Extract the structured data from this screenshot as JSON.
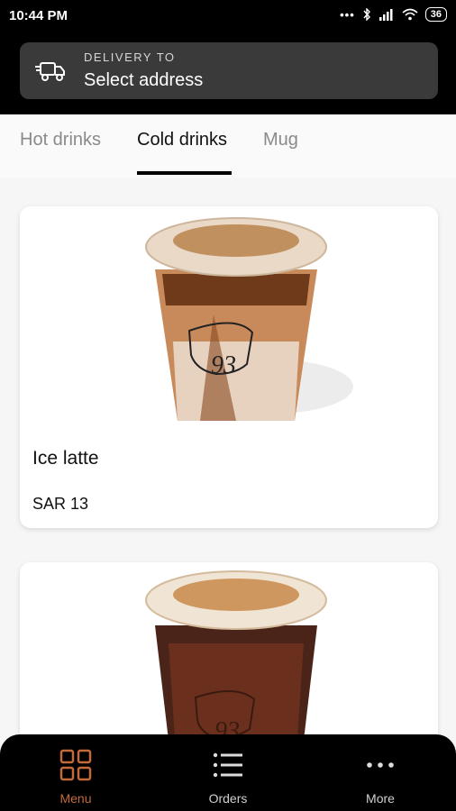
{
  "status_bar": {
    "time": "10:44 PM",
    "signal_dots": "•••",
    "battery": "36"
  },
  "delivery": {
    "label": "DELIVERY TO",
    "value": "Select address"
  },
  "tabs": [
    {
      "label": "Hot drinks",
      "active": false
    },
    {
      "label": "Cold drinks",
      "active": true
    },
    {
      "label": "Mug",
      "active": false
    }
  ],
  "products": [
    {
      "name": "Ice latte",
      "price": "SAR 13"
    },
    {
      "name": "",
      "price": ""
    }
  ],
  "bottom_nav": {
    "items": [
      {
        "label": "Menu",
        "icon": "grid-icon",
        "active": true
      },
      {
        "label": "Orders",
        "icon": "list-icon",
        "active": false
      },
      {
        "label": "More",
        "icon": "more-icon",
        "active": false
      }
    ]
  },
  "colors": {
    "accent": "#c26a3a",
    "header": "#000000",
    "delivery_bg": "#3a3a3a"
  }
}
